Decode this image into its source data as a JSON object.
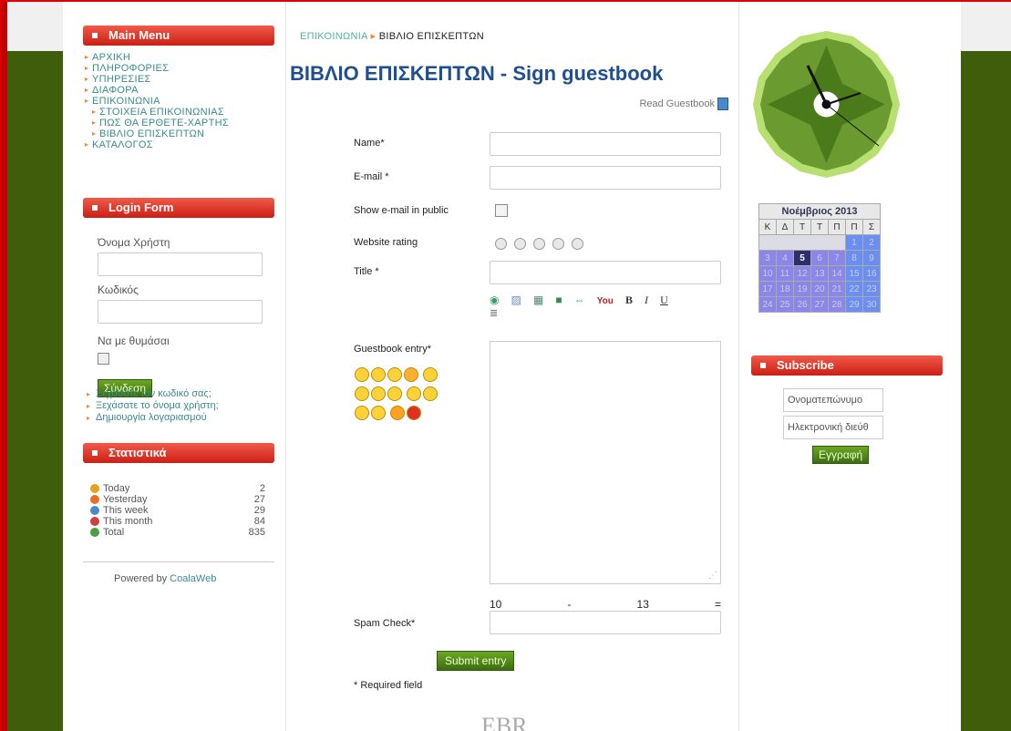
{
  "menu": {
    "title": "Main Menu",
    "items": [
      "ΑΡΧΙΚΗ",
      "ΠΛΗΡΟΦΟΡΙΕΣ",
      "ΥΠΗΡΕΣΙΕΣ",
      "ΔΙΑΦΟΡΑ",
      "ΕΠΙΚΟΙΝΩΝΙΑ",
      "ΣΤΟΙΧΕΙΑ ΕΠΙΚΟΙΝΩΝΙΑΣ",
      "ΠΩΣ ΘΑ ΕΡΘΕΤΕ-ΧΑΡΤΗΣ",
      "ΒΙΒΛΙΟ ΕΠΙΣΚΕΠΤΩΝ",
      "ΚΑΤΑΛΟΓΟΣ"
    ]
  },
  "login": {
    "title": "Login Form",
    "username_label": "Όνομα Χρήστη",
    "password_label": "Κωδικός",
    "remember_label": "Να με θυμάσαι",
    "submit": "Σύνδεση",
    "links": [
      "Ξεχάσατε τον κωδικό σας;",
      "Ξεχάσατε το όνομα χρήστη;",
      "Δημιουργία λογαριασμού"
    ]
  },
  "stats": {
    "title": "Στατιστικά",
    "rows": [
      {
        "label": "Today",
        "value": "2",
        "color": "#e8a020"
      },
      {
        "label": "Yesterday",
        "value": "27",
        "color": "#e87020"
      },
      {
        "label": "This week",
        "value": "29",
        "color": "#4a8ac8"
      },
      {
        "label": "This month",
        "value": "84",
        "color": "#d04040"
      },
      {
        "label": "Total",
        "value": "835",
        "color": "#4aa040"
      }
    ],
    "powered_prefix": "Powered by",
    "powered_link": "CoalaWeb"
  },
  "breadcrumb": {
    "parent": "ΕΠΙΚΟΙΝΩΝΙΑ",
    "current": "ΒΙΒΛΙΟ ΕΠΙΣΚΕΠΤΩΝ"
  },
  "form": {
    "title": "ΒΙΒΛΙΟ ΕΠΙΣΚΕΠΤΩΝ - Sign guestbook",
    "read_link": "Read Guestbook",
    "name_label": "Name*",
    "email_label": "E-mail *",
    "show_email_label": "Show e-mail in public",
    "rating_label": "Website rating",
    "title_label": "Title *",
    "entry_label": "Guestbook entry*",
    "spam_label": "Spam Check*",
    "spam_a": "10",
    "spam_op": "-",
    "spam_b": "13",
    "spam_eq": "=",
    "submit": "Submit entry",
    "required_note": "* Required field",
    "logo": "EBR",
    "toolbar": [
      "image-icon",
      "picture-icon",
      "gallery-icon",
      "video-icon",
      "link-icon",
      "youtube-icon",
      "B",
      "I",
      "U"
    ]
  },
  "calendar": {
    "caption": "Νοέμβριος 2013",
    "days": [
      "Κ",
      "Δ",
      "Τ",
      "Τ",
      "Π",
      "Π",
      "Σ"
    ],
    "weeks": [
      [
        "",
        "",
        "",
        "",
        "",
        "1",
        "2"
      ],
      [
        "3",
        "4",
        "5",
        "6",
        "7",
        "8",
        "9"
      ],
      [
        "10",
        "11",
        "12",
        "13",
        "14",
        "15",
        "16"
      ],
      [
        "17",
        "18",
        "19",
        "20",
        "21",
        "22",
        "23"
      ],
      [
        "24",
        "25",
        "26",
        "27",
        "28",
        "29",
        "30"
      ]
    ],
    "today": "5"
  },
  "subscribe": {
    "title": "Subscribe",
    "name_placeholder": "Ονοματεπώνυμο",
    "email_placeholder": "Ηλεκτρονική διεύθ",
    "submit": "Εγγραφή"
  }
}
